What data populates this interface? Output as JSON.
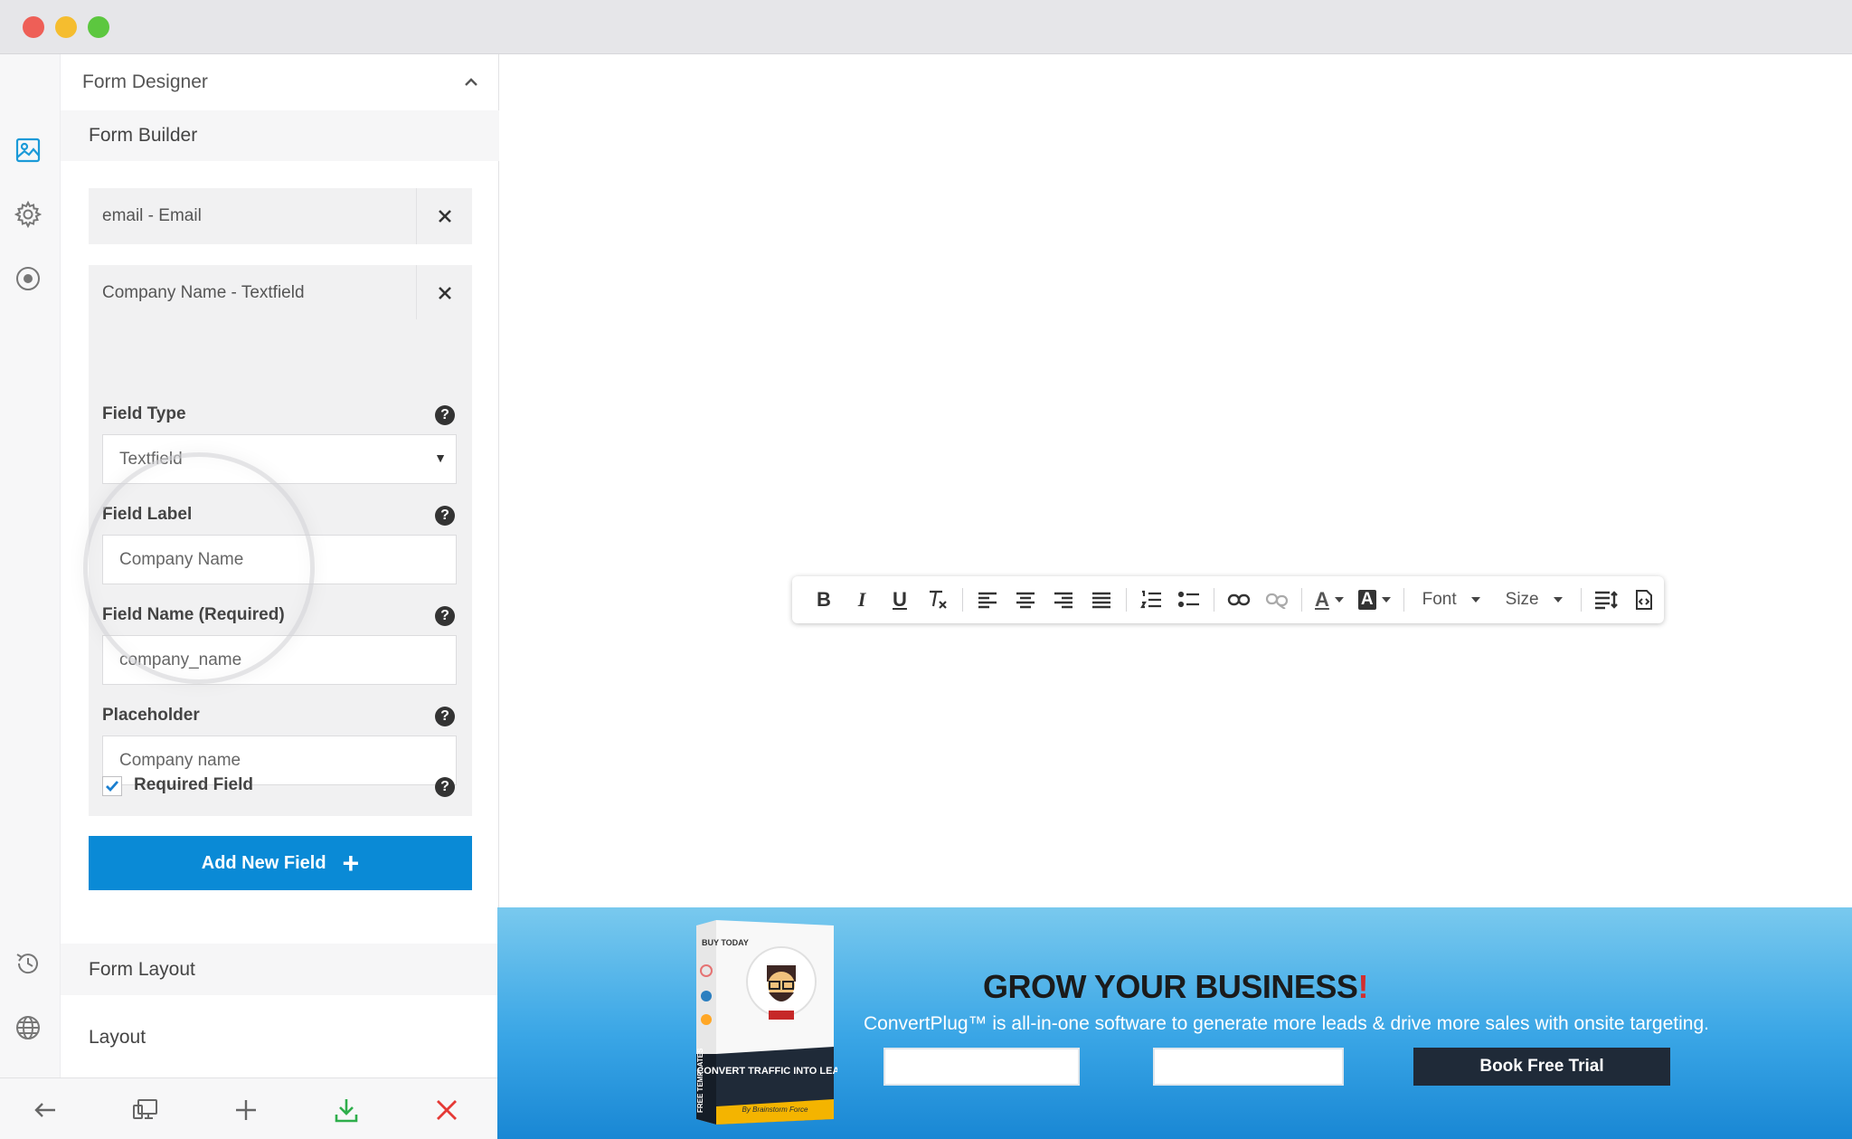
{
  "window": {
    "controls": [
      "close",
      "minimize",
      "maximize"
    ]
  },
  "rail": {
    "icons": [
      "image-icon",
      "gear-icon",
      "target-icon",
      "history-icon",
      "globe-icon"
    ]
  },
  "panel": {
    "title": "Form Designer",
    "builder_title": "Form Builder",
    "fields": [
      {
        "label": "email - Email"
      },
      {
        "label": "Company Name - Textfield"
      }
    ],
    "field_type": {
      "label": "Field Type",
      "value": "Textfield"
    },
    "field_label": {
      "label": "Field Label",
      "value": "Company Name"
    },
    "field_name": {
      "label": "Field Name (Required)",
      "value": "company_name"
    },
    "placeholder": {
      "label": "Placeholder",
      "value": "Company name"
    },
    "required": {
      "label": "Required Field",
      "checked": true
    },
    "add_button": "Add New Field",
    "sections": [
      "Form Layout",
      "Layout"
    ]
  },
  "bottombar": {
    "buttons": [
      "back-icon",
      "device-preview-icon",
      "add-icon",
      "download-icon",
      "close-icon"
    ],
    "colors": {
      "download": "#2eae4b",
      "close": "#e53935"
    }
  },
  "editor_toolbar": {
    "font_label": "Font",
    "size_label": "Size",
    "buttons": [
      "bold",
      "italic",
      "underline",
      "clear-format",
      "align-left",
      "align-center",
      "align-right",
      "justify",
      "ordered-list",
      "unordered-list",
      "link",
      "unlink",
      "text-color",
      "background-color",
      "font",
      "size",
      "line-height",
      "source"
    ]
  },
  "banner": {
    "product_lines": [
      "BUY TODAY",
      "CONVERT TRAFFIC INTO LEADS",
      "By Brainstorm Force",
      "FREE TEMPLATES"
    ],
    "title": "GROW YOUR BUSINESS",
    "title_mark": "!",
    "subtitle": "ConvertPlug™ is all-in-one software to generate more leads & drive more sales with onsite targeting.",
    "button": "Book Free Trial",
    "colors": {
      "accent": "#0a8ad6",
      "button_bg": "#1f2a38",
      "title_mark": "#d32f2f"
    }
  }
}
